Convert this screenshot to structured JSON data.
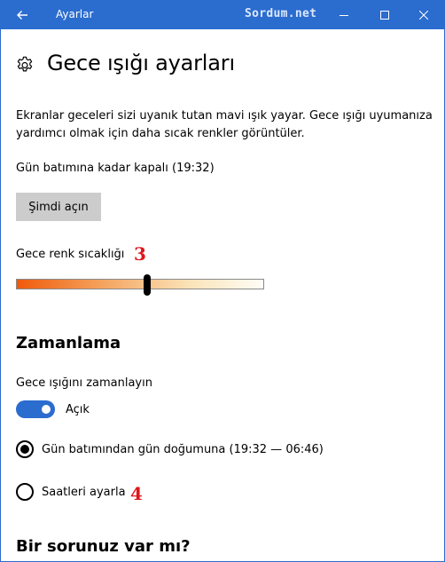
{
  "titlebar": {
    "title": "Ayarlar",
    "watermark": "Sordum.net",
    "back_icon": "arrow-left-icon",
    "minimize_icon": "minimize-icon",
    "maximize_icon": "maximize-icon",
    "close_icon": "close-icon",
    "color": "#2b6ccf"
  },
  "page": {
    "icon": "gear-icon",
    "title": "Gece ışığı ayarları",
    "description": "Ekranlar geceleri sizi uyanık tutan mavi ışık yayar. Gece ışığı uyumanıza yardımcı olmak için daha sıcak renkler görüntüler.",
    "status": "Gün batımına kadar kapalı (19:32)",
    "turn_on_button": "Şimdi açın"
  },
  "temperature": {
    "label": "Gece renk sıcaklığı",
    "annotation": "3",
    "level": 0.53
  },
  "schedule": {
    "heading": "Zamanlama",
    "label": "Gece ışığını zamanlayın",
    "toggle_state": "Açık",
    "toggle_on": true,
    "options": [
      {
        "label": "Gün batımından gün doğumuna (19:32 — 06:46)",
        "selected": true
      },
      {
        "label": "Saatleri ayarla",
        "selected": false,
        "annotation": "4"
      }
    ]
  },
  "help": {
    "heading": "Bir sorunuz var mı?"
  },
  "colors": {
    "accent": "#2b6ccf",
    "annotation": "#e0161b",
    "button_bg": "#cccccc"
  }
}
